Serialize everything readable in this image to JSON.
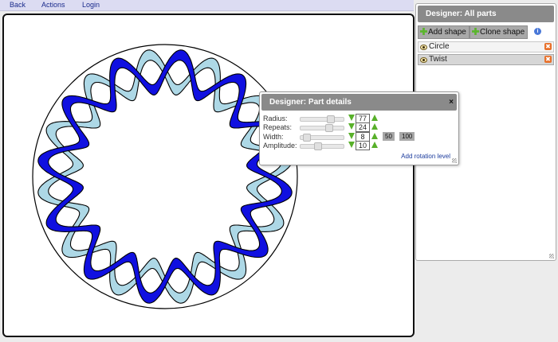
{
  "menu": {
    "back": "Back",
    "actions": "Actions",
    "login": "Login"
  },
  "parts_panel": {
    "title": "Designer: All parts",
    "add_shape": "Add shape",
    "clone_shape": "Clone shape",
    "parts": [
      {
        "label": "Circle",
        "selected": false
      },
      {
        "label": "Twist",
        "selected": true
      }
    ]
  },
  "details": {
    "title": "Designer: Part details",
    "close": "×",
    "params": [
      {
        "label": "Radius:",
        "value": "77",
        "slider": 0.72
      },
      {
        "label": "Repeats:",
        "value": "24",
        "slider": 0.68
      },
      {
        "label": "Width:",
        "value": "8",
        "slider": 0.06
      },
      {
        "label": "Amplitude:",
        "value": "10",
        "slider": 0.38
      }
    ],
    "presets": [
      "50",
      "100"
    ],
    "rotation_link": "Add rotation level"
  },
  "shape": {
    "circle_color": "#000000",
    "strand_a_color": "#1010e0",
    "strand_b_color": "#add8e6",
    "outline_color": "#000000",
    "repeats": 24
  }
}
